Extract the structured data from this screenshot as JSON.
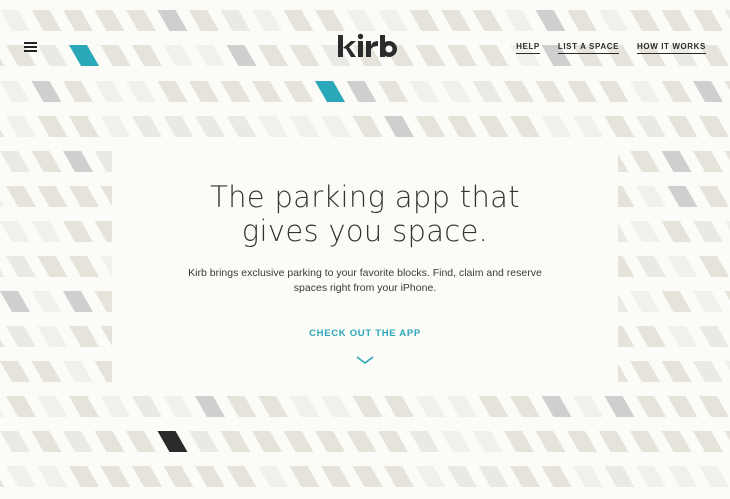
{
  "header": {
    "menu_icon": "hamburger-menu-icon",
    "logo_text": "kirb",
    "nav": [
      {
        "label": "HELP"
      },
      {
        "label": "LIST A SPACE"
      },
      {
        "label": "HOW IT WORKS"
      }
    ]
  },
  "hero": {
    "headline_line1": "The parking app that",
    "headline_line2": "gives you space.",
    "subtext": "Kirb brings exclusive parking to your favorite blocks. Find, claim and reserve spaces right from your iPhone.",
    "cta_label": "CHECK OUT THE APP",
    "cta_icon": "chevron-down-icon"
  },
  "colors": {
    "background": "#fbfbf8",
    "accent": "#2aa7b8",
    "text": "#333333",
    "stripe_beige": "#e6e3da",
    "stripe_light": "#f1f0ec",
    "stripe_gray": "#cfcfcf",
    "stripe_teal": "#2aa7b8",
    "stripe_dark": "#2b2b2b"
  }
}
